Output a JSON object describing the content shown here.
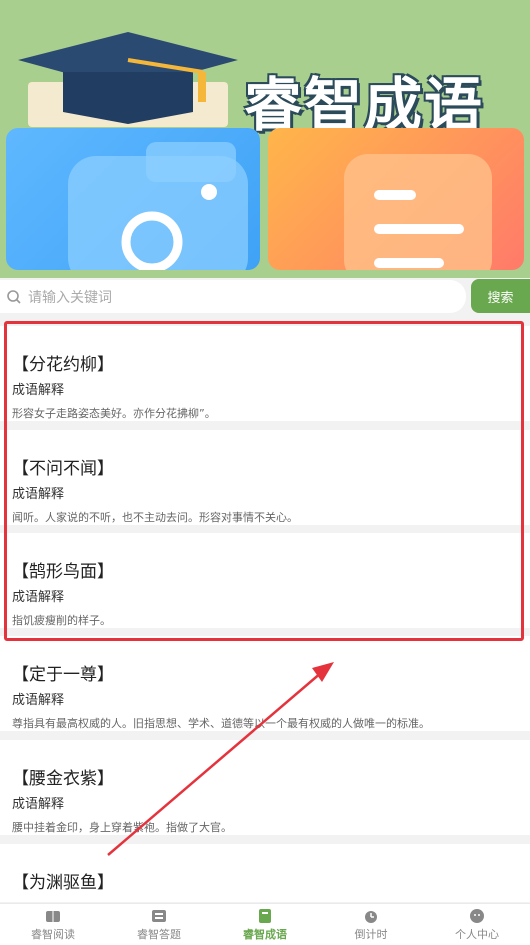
{
  "banner": {
    "title": "睿智成语"
  },
  "search": {
    "placeholder": "请输入关键词",
    "button": "搜索"
  },
  "idioms": [
    {
      "name": "【分花约柳】",
      "label": "成语解释",
      "desc": "形容女子走路姿态美好。亦作分花拂柳”。"
    },
    {
      "name": "【不问不闻】",
      "label": "成语解释",
      "desc": "闻听。人家说的不听，也不主动去问。形容对事情不关心。"
    },
    {
      "name": "【鹄形鸟面】",
      "label": "成语解释",
      "desc": "指饥疲瘦削的样子。"
    },
    {
      "name": "【定于一尊】",
      "label": "成语解释",
      "desc": "尊指具有最高权威的人。旧指思想、学术、道德等以一个最有权威的人做唯一的标准。"
    },
    {
      "name": "【腰金衣紫】",
      "label": "成语解释",
      "desc": "腰中挂着金印，身上穿着紫袍。指做了大官。"
    },
    {
      "name": "【为渊驱鱼】",
      "label": "",
      "desc": ""
    }
  ],
  "tabs": [
    {
      "label": "睿智阅读",
      "icon": "book-icon"
    },
    {
      "label": "睿智答题",
      "icon": "quiz-icon"
    },
    {
      "label": "睿智成语",
      "icon": "idiom-book-icon",
      "active": true
    },
    {
      "label": "倒计时",
      "icon": "alarm-clock-icon"
    },
    {
      "label": "个人中心",
      "icon": "user-icon"
    }
  ],
  "colors": {
    "accent": "#6aa84f",
    "highlight": "#e5333d",
    "banner": "#a9cf8e"
  }
}
